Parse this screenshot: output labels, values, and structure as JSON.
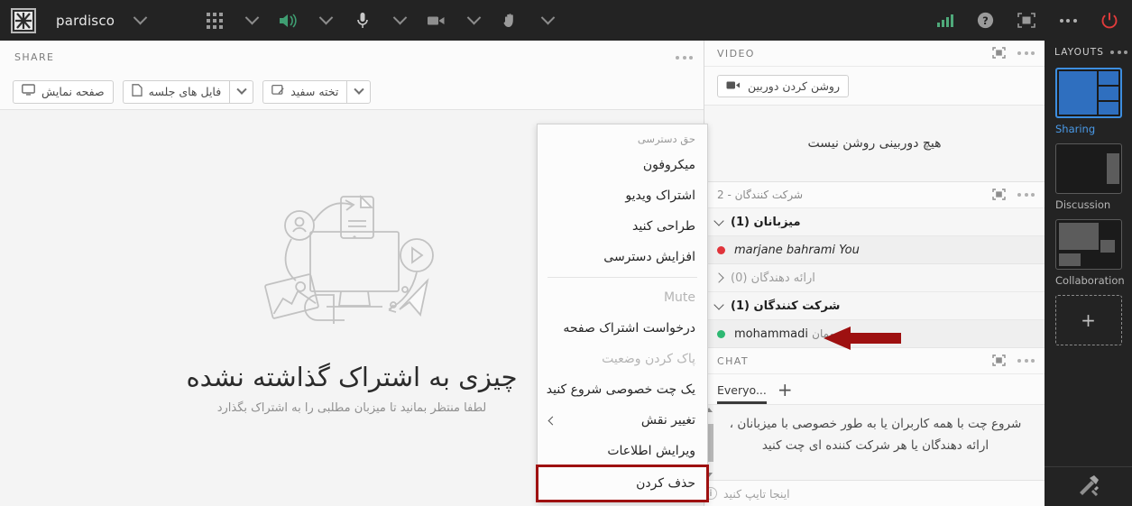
{
  "topbar": {
    "logo_icon": "pardisco-logo-icon",
    "app_name": "pardisco",
    "app_caret_icon": "chevron-down-icon",
    "grid_icon": "apps-grid-icon",
    "grid_caret_icon": "chevron-down-icon",
    "speaker_icon": "speaker-on-icon",
    "speaker_caret_icon": "chevron-down-icon",
    "mic_icon": "microphone-icon",
    "mic_caret_icon": "chevron-down-icon",
    "camera_icon": "video-camera-icon",
    "camera_caret_icon": "chevron-down-icon",
    "hand_icon": "raise-hand-icon",
    "hand_caret_icon": "chevron-down-icon",
    "signal_icon": "network-signal-icon",
    "help_icon": "help-question-icon",
    "fullscreen_icon": "fullscreen-icon",
    "more_icon": "more-options-icon",
    "power_icon": "power-leave-icon"
  },
  "share": {
    "label": "SHARE",
    "more_icon": "more-options-icon",
    "buttons": [
      {
        "label": "صفحه نمایش",
        "icon": "monitor-icon",
        "has_caret": false
      },
      {
        "label": "فایل های جلسه",
        "icon": "document-icon",
        "has_caret": true
      },
      {
        "label": "تخته سفید",
        "icon": "whiteboard-icon",
        "has_caret": true
      }
    ],
    "empty_title": "چیزی به اشتراک گذاشته نشده",
    "empty_subtitle": "لطفا منتظر بمانید تا میزبان مطلبی را به اشتراک بگذارد",
    "illustration_icon": "share-content-illustration"
  },
  "context_menu": {
    "group_label": "حق دسترسی",
    "items": [
      {
        "label": "میکروفون",
        "state": "enabled",
        "submenu": false
      },
      {
        "label": "اشتراک ویدیو",
        "state": "enabled",
        "submenu": false
      },
      {
        "label": "طراحی کنید",
        "state": "enabled",
        "submenu": false
      },
      {
        "label": "افزایش دسترسی",
        "state": "enabled",
        "submenu": false
      },
      {
        "label": "Mute",
        "state": "disabled",
        "submenu": false
      },
      {
        "label": "درخواست اشتراک صفحه",
        "state": "enabled",
        "submenu": false
      },
      {
        "label": "پاک کردن وضعیت",
        "state": "disabled",
        "submenu": false
      },
      {
        "label": "یک چت خصوصی شروع کنید",
        "state": "enabled",
        "submenu": false
      },
      {
        "label": "تغییر نقش",
        "state": "enabled",
        "submenu": true
      },
      {
        "label": "ویرایش اطلاعات",
        "state": "enabled",
        "submenu": false
      },
      {
        "label": "حذف کردن",
        "state": "enabled",
        "submenu": false,
        "highlighted": true
      }
    ],
    "highlight_color": "#9e1010",
    "submenu_icon": "chevron-right-icon"
  },
  "video": {
    "label": "VIDEO",
    "expand_icon": "expand-panel-icon",
    "more_icon": "more-options-icon",
    "turn_on_camera_label": "روشن کردن دوربین",
    "camera_icon": "video-camera-icon",
    "empty_text": "هیچ دوربینی روشن نیست"
  },
  "participants": {
    "label": "شرکت کنندگان - 2",
    "expand_icon": "expand-panel-icon",
    "more_icon": "more-options-icon",
    "groups": [
      {
        "label": "میزبانان (1)",
        "expanded": true,
        "caret_icon": "chevron-down-icon",
        "members": [
          {
            "name": "marjane bahrami",
            "suffix": "You",
            "status_color": "#e0333a"
          }
        ]
      },
      {
        "label": "ارائه دهندگان (0)",
        "expanded": false,
        "caret_icon": "chevron-right-icon",
        "members": []
      },
      {
        "label": "شرکت کنندگان (1)",
        "expanded": true,
        "caret_icon": "chevron-down-icon",
        "members": [
          {
            "name": "mohammadi",
            "suffix": "مهمان",
            "status_color": "#2eb872"
          }
        ]
      }
    ]
  },
  "chat": {
    "label": "CHAT",
    "expand_icon": "expand-panel-icon",
    "more_icon": "more-options-icon",
    "tab_label": "Everyo...",
    "add_tab_icon": "plus-icon",
    "message": "شروع چت با همه کاربران یا به طور خصوصی با میزبانان ، ارائه دهندگان یا هر شرکت کننده ای چت کنید",
    "input_placeholder": "اینجا تایپ کنید",
    "info_icon": "info-icon",
    "scroll_up_icon": "scroll-up-icon",
    "scroll_down_icon": "scroll-down-icon"
  },
  "layouts": {
    "label": "LAYOUTS",
    "more_icon": "more-options-icon",
    "items": [
      {
        "label": "Sharing",
        "selected": true
      },
      {
        "label": "Discussion",
        "selected": false
      },
      {
        "label": "Collaboration",
        "selected": false
      }
    ],
    "add_layout_icon": "plus-icon",
    "tools_icon": "tools-hammer-icon",
    "accent_color": "#3d8ee0"
  },
  "annotation": {
    "arrow_icon": "red-pointer-arrow",
    "color": "#9e1010"
  }
}
